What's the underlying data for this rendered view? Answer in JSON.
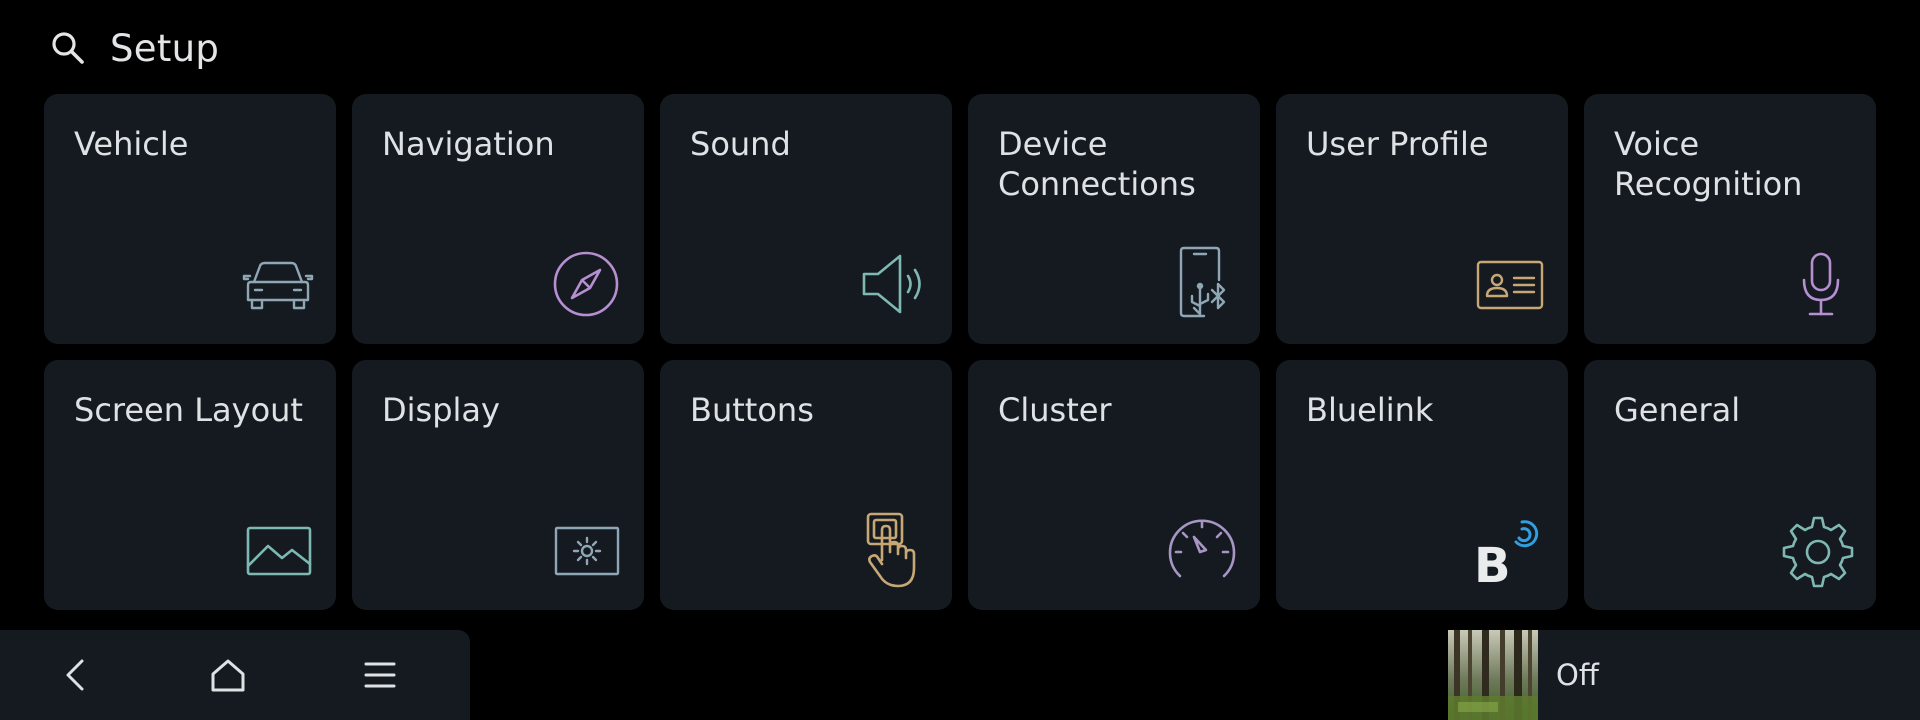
{
  "header": {
    "title": "Setup",
    "search_icon": "search-icon"
  },
  "tiles": [
    {
      "label": "Vehicle",
      "icon": "car-icon",
      "color": "#8fa7b5"
    },
    {
      "label": "Navigation",
      "icon": "compass-icon",
      "color": "#b58fd0"
    },
    {
      "label": "Sound",
      "icon": "speaker-icon",
      "color": "#7fb8b2"
    },
    {
      "label": "Device\nConnections",
      "icon": "phone-usb-bluetooth-icon",
      "color": "#8fa7b5"
    },
    {
      "label": "User Profile",
      "icon": "id-card-icon",
      "color": "#c7a875"
    },
    {
      "label": "Voice\nRecognition",
      "icon": "microphone-icon",
      "color": "#b58fd0"
    },
    {
      "label": "Screen Layout",
      "icon": "image-icon",
      "color": "#7fb8b2"
    },
    {
      "label": "Display",
      "icon": "brightness-icon",
      "color": "#8fa7b5"
    },
    {
      "label": "Buttons",
      "icon": "hand-press-icon",
      "color": "#c7a875"
    },
    {
      "label": "Cluster",
      "icon": "speedometer-icon",
      "color": "#a796c4"
    },
    {
      "label": "Bluelink",
      "icon": "bluelink-icon",
      "color": "#2f9fe0"
    },
    {
      "label": "General",
      "icon": "gear-icon",
      "color": "#7fb8b2"
    }
  ],
  "navbar": {
    "items": [
      "back-icon",
      "home-icon",
      "menu-icon"
    ]
  },
  "media": {
    "status": "Off",
    "thumb": "forest-thumbnail"
  }
}
